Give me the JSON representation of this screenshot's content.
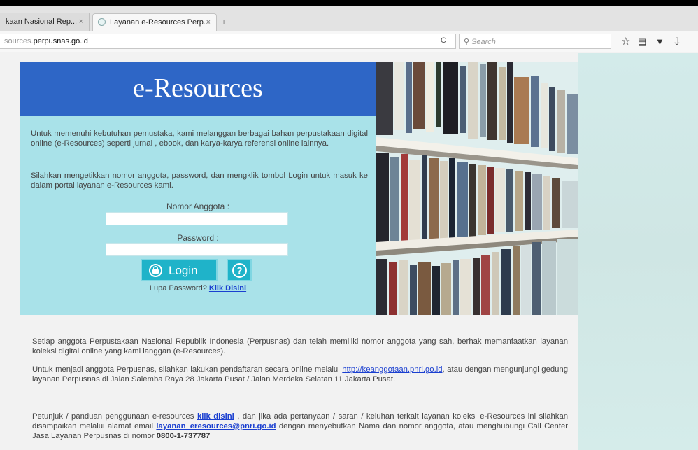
{
  "browser": {
    "tabs": [
      {
        "label": "kaan Nasional Rep...",
        "close": "×",
        "active": false
      },
      {
        "label": "Layanan e-Resources Perp...",
        "close": "×",
        "active": true
      }
    ],
    "new_tab": "+",
    "url_prefix": "sources.",
    "url_domain": "perpusnas.go.id",
    "reload": "C",
    "search_placeholder": "Search",
    "icons": [
      "search-icon",
      "bookmark-star-icon",
      "reading-list-icon",
      "pocket-icon",
      "download-icon"
    ]
  },
  "login": {
    "title": "e-Resources",
    "intro1": "Untuk memenuhi kebutuhan pemustaka, kami melanggan berbagai bahan perpustakaan digital online (e-Resources) seperti jurnal , ebook, dan karya-karya referensi online lainnya.",
    "intro2": "Silahkan mengetikkan nomor anggota, password, dan mengklik tombol Login untuk masuk ke dalam portal layanan e-Resources kami.",
    "member_label": "Nomor Anggota :",
    "password_label": "Password :",
    "member_value": "",
    "password_value": "",
    "login_button": "Login",
    "help_button": "?",
    "forgot_text": "Lupa Password?",
    "forgot_link": "Klik Disini"
  },
  "info": {
    "p1": "Setiap anggota Perpustakaan Nasional Republik Indonesia (Perpusnas) dan telah memiliki nomor anggota yang sah, berhak memanfaatkan layanan koleksi digital online yang kami langgan (e-Resources).",
    "p2_before": "Untuk menjadi anggota Perpusnas, silahkan lakukan pendaftaran secara online melalui",
    "p2_link": "http://keanggotaan.pnri.go.id",
    "p2_after": ", atau dengan mengunjungi gedung layanan Perpusnas di Jalan Salemba Raya 28 Jakarta Pusat / Jalan Merdeka Selatan 11 Jakarta Pusat.",
    "p3_before": "Petunjuk / panduan penggunaan e-resources",
    "p3_link": "klik disini",
    "p3_mid": ", dan jika ada pertanyaan / saran / keluhan terkait layanan koleksi e-Resources ini silahkan disampaikan melalui alamat email",
    "p3_email": "layanan_eresources@pnri.go.id",
    "p3_mid2": "dengan menyebutkan Nama dan nomor anggota, atau menghubungi Call Center Jasa Layanan Perpusnas di nomor",
    "p3_phone": "0800-1-737787"
  },
  "colors": {
    "header_blue": "#2e66c6",
    "panel_cyan": "#a9e2e9",
    "button_teal": "#1fb3c9",
    "link_blue": "#1a3fd0",
    "annotation_red": "#d91e1e"
  }
}
